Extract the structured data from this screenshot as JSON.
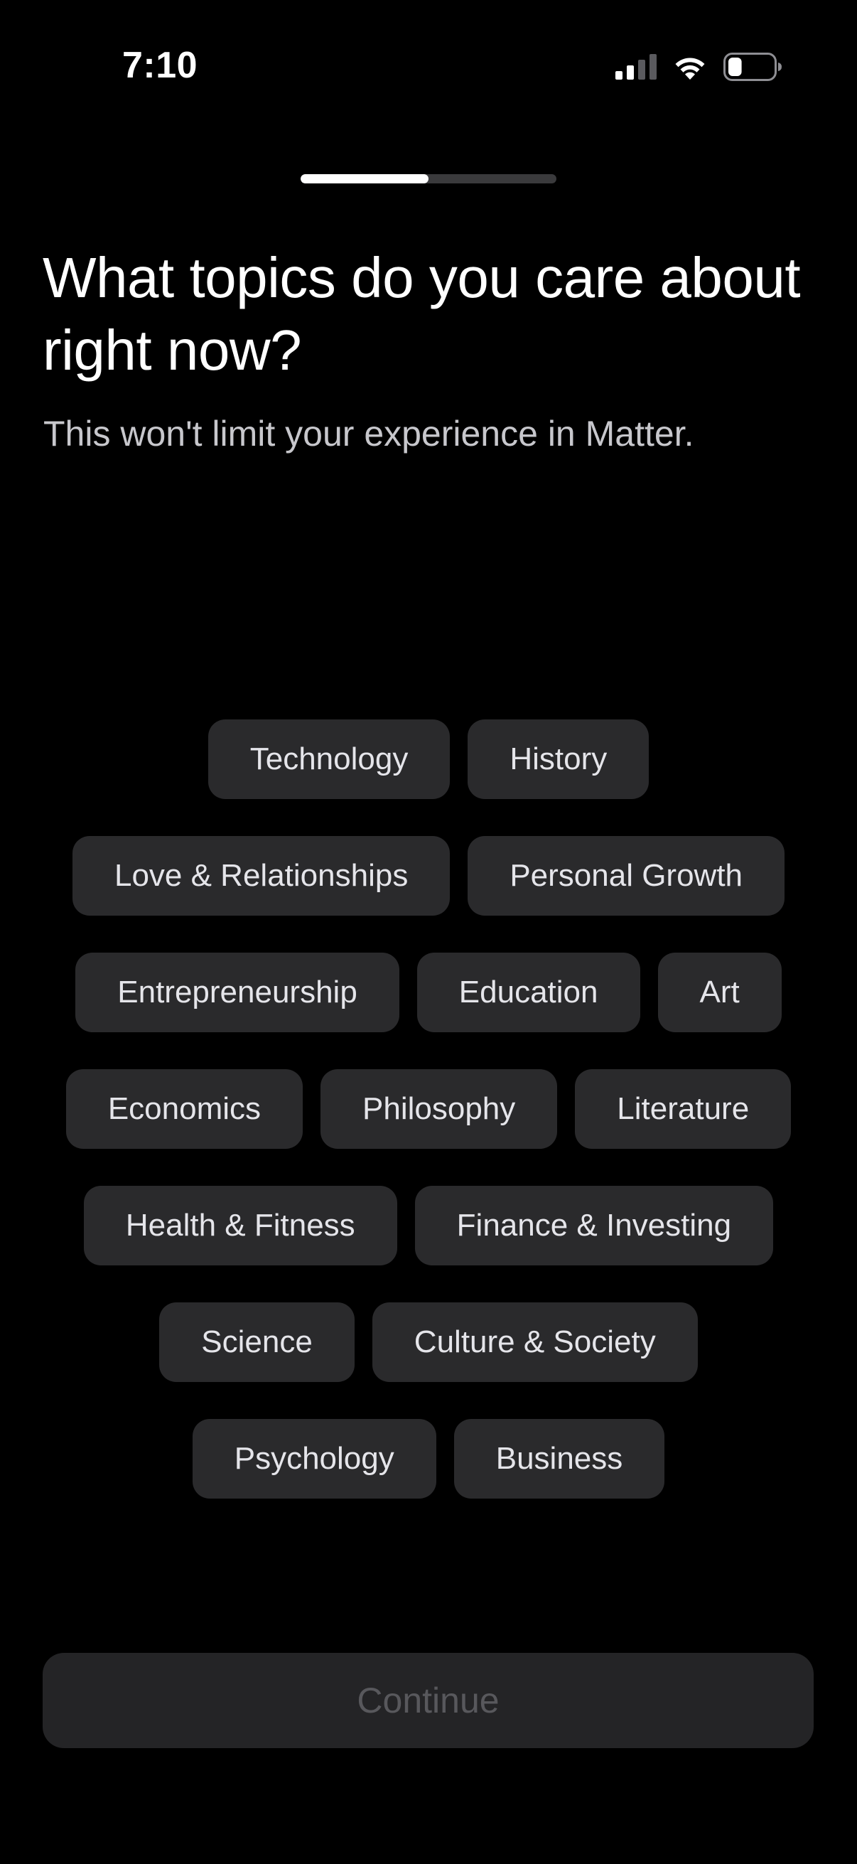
{
  "status_bar": {
    "time": "7:10",
    "icons": [
      "cellular-signal-icon",
      "wifi-icon",
      "battery-icon"
    ],
    "battery_level": 0.3
  },
  "progress": {
    "fraction": 0.5
  },
  "header": {
    "title": "What topics do you care about right now?",
    "subtitle": "This won't limit your experience in Matter."
  },
  "topics": [
    "Technology",
    "History",
    "Love & Relationships",
    "Personal Growth",
    "Entrepreneurship",
    "Education",
    "Art",
    "Economics",
    "Philosophy",
    "Literature",
    "Health & Fitness",
    "Finance & Investing",
    "Science",
    "Culture & Society",
    "Psychology",
    "Business"
  ],
  "footer": {
    "continue_label": "Continue"
  },
  "colors": {
    "background": "#000000",
    "chip_background": "#2a2a2c",
    "chip_text": "#e5e5ea",
    "button_disabled_background": "#242426",
    "button_disabled_text": "#58585c"
  }
}
